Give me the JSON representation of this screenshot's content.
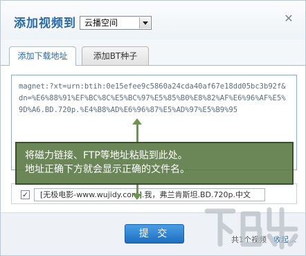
{
  "header": {
    "title": "添加视频到",
    "destination_value": "云播空间",
    "close_glyph": "✕"
  },
  "tabs": [
    {
      "label": "添加下载地址"
    },
    {
      "label": "添加BT种子"
    }
  ],
  "link_input": {
    "value": "magnet:?xt=urn:btih:0e15efee9c5860a24cda40af67e18dd05bc3b92f&dn=%E6%88%91%EF%BC%8C%E5%BC%97%E5%85%B0%E8%82%AF%E6%96%AF%E5%9D%A6.BD.720p.%E4%B8%AD%E6%96%87%E5%AD%97%E5%B9%95"
  },
  "tooltip": {
    "line1": "将磁力链接、FTP等地址粘贴到此处。",
    "line2": "地址正确下方就会显示正确的文件名。"
  },
  "file": {
    "checked": true,
    "check_glyph": "✓",
    "name": "[无极电影-www.wujidy.com].我，弗兰肯斯坦.BD.720p.中文"
  },
  "footer": {
    "submit_label": "提 交",
    "count_text": "共1个视频",
    "collapse_label": "收起",
    "collapse_icon": "chevron-up-icon"
  },
  "watermark": {
    "text": "下载吧",
    "color": "#b5bcc3"
  },
  "colors": {
    "accent": "#2a6aa6",
    "tooltip_bg": "#567640",
    "submit_bg": "#2a82d2"
  }
}
